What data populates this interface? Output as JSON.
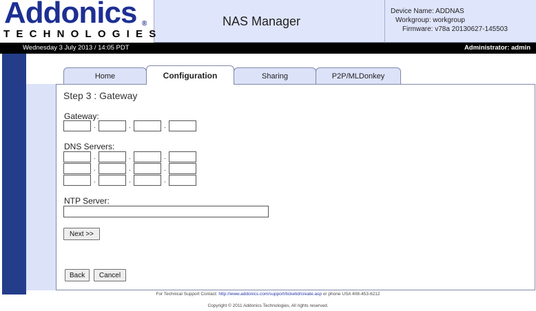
{
  "header": {
    "logo": {
      "wordmark": "Addonics",
      "registered": "®",
      "tagline": "TECHNOLOGIES"
    },
    "app_title": "NAS Manager",
    "device": {
      "name_line": "Device Name: ADDNAS",
      "workgroup_line": "Workgroup: workgroup",
      "firmware_line": "Firmware: v78a 20130627-145503"
    }
  },
  "statusbar": {
    "datetime": "Wednesday 3 July 2013 / 14:05 PDT",
    "user": "Administrator: admin"
  },
  "tabs": [
    {
      "label": "Home",
      "active": false
    },
    {
      "label": "Configuration",
      "active": true
    },
    {
      "label": "Sharing",
      "active": false
    },
    {
      "label": "P2P/MLDonkey",
      "active": false
    }
  ],
  "form": {
    "step_title": "Step 3 : Gateway",
    "gateway_label": "Gateway:",
    "gateway": [
      "",
      "",
      "",
      ""
    ],
    "dns_label": "DNS Servers:",
    "dns": [
      [
        "",
        "",
        "",
        ""
      ],
      [
        "",
        "",
        "",
        ""
      ],
      [
        "",
        "",
        "",
        ""
      ]
    ],
    "ntp_label": "NTP Server:",
    "ntp_value": "",
    "next_label": "Next >>",
    "back_label": "Back",
    "cancel_label": "Cancel"
  },
  "footer": {
    "support_prefix": "For Technical Support Contact:",
    "support_link": "http://www.addonics.com/support/ticketid/create.asp",
    "support_suffix": "or phone USA 408-453-6212",
    "copyright": "Copyright © 2011 Addonics Technologies, All rights reserved."
  },
  "colors": {
    "brand_blue": "#1d2f93",
    "header_bg": "#dfe5fb",
    "sidebar_blue": "#233d8b",
    "status_bar": "#000000"
  }
}
